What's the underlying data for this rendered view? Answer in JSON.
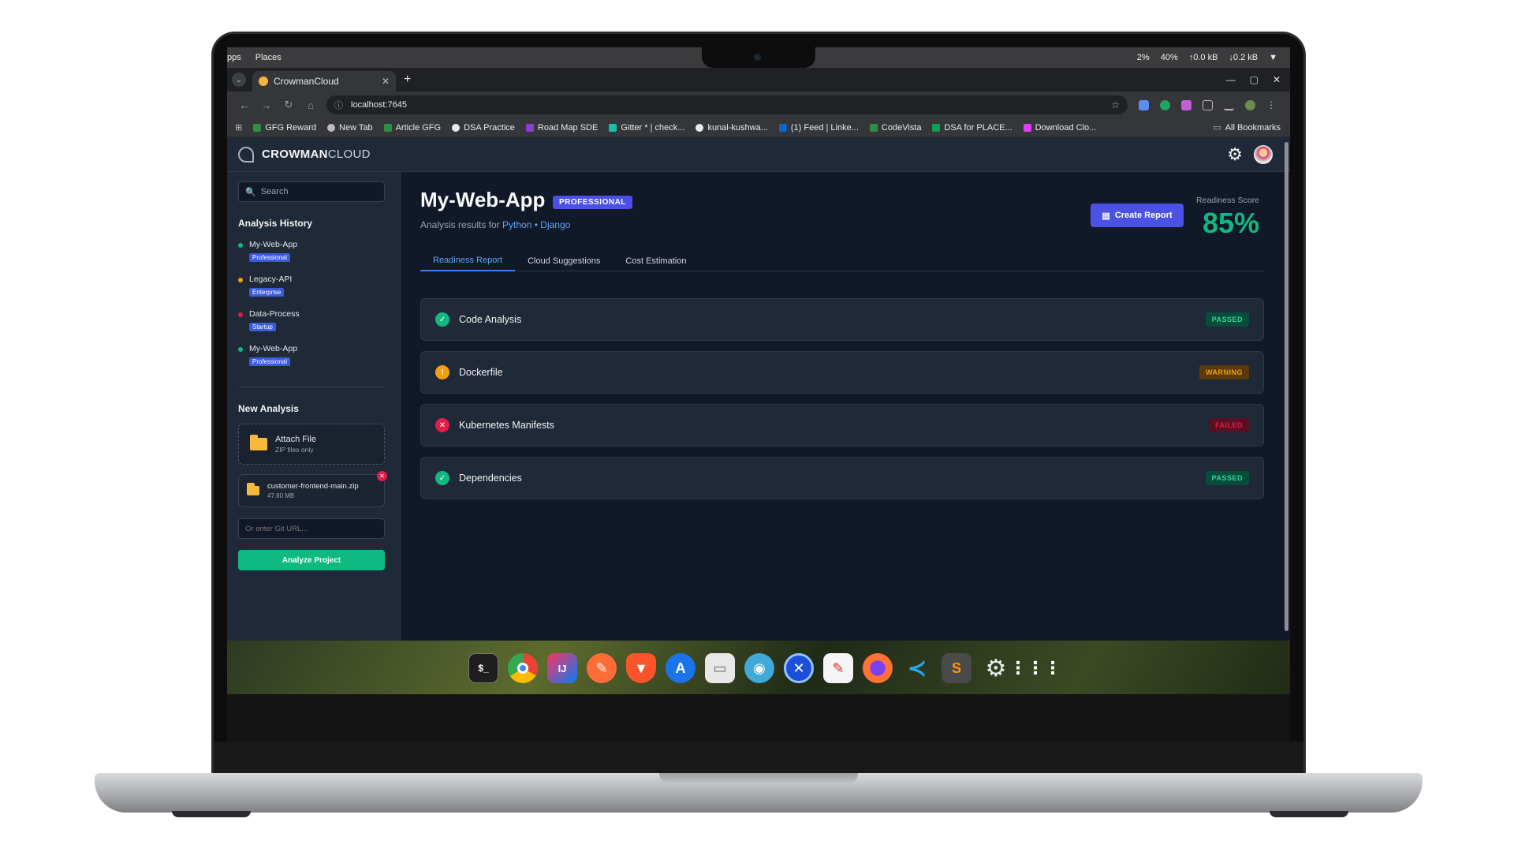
{
  "os_bar": {
    "left": [
      "pps",
      "Places"
    ],
    "right": [
      "2%",
      "40%",
      "↑0.0 kB",
      "↓0.2 kB"
    ]
  },
  "browser": {
    "tab_title": "CrowmanCloud",
    "new_tab_symbol": "+",
    "url": "localhost:7645",
    "bookmarks": [
      "GFG Reward",
      "New Tab",
      "Article GFG",
      "DSA Practice",
      "Road Map SDE",
      "Gitter * | check...",
      "kunal-kushwa...",
      "(1) Feed | Linke...",
      "CodeVista",
      "DSA for PLACE...",
      "Download Clo..."
    ],
    "all_bookmarks": "All Bookmarks"
  },
  "app": {
    "brand_bold": "CROWMAN",
    "brand_light": "CLOUD",
    "search_placeholder": "Search",
    "history_title": "Analysis History",
    "history": [
      {
        "name": "My-Web-App",
        "tier": "Professional",
        "status_color": "#10b981"
      },
      {
        "name": "Legacy-API",
        "tier": "Enterprise",
        "status_color": "#f59e0b"
      },
      {
        "name": "Data-Process",
        "tier": "Startup",
        "status_color": "#e11d48"
      },
      {
        "name": "My-Web-App",
        "tier": "Professional",
        "status_color": "#10b981"
      }
    ],
    "new_analysis_title": "New Analysis",
    "attach": {
      "title": "Attach File",
      "subtitle": "ZIP files only"
    },
    "file": {
      "name": "customer-frontend-main.zip",
      "size": "47.80 MB"
    },
    "git_placeholder": "Or enter Git URL...",
    "analyze_label": "Analyze Project"
  },
  "main": {
    "project_title": "My-Web-App",
    "project_badge": "PROFESSIONAL",
    "results_prefix": "Analysis results for",
    "stack": "Python • Django",
    "create_report_label": "Create Report",
    "readiness_label": "Readiness Score",
    "readiness_score": "85%",
    "tabs": [
      "Readiness Report",
      "Cloud Suggestions",
      "Cost Estimation"
    ],
    "checks": [
      {
        "label": "Code Analysis",
        "status": "PASSED",
        "symbol": "✓",
        "color": "#10b981"
      },
      {
        "label": "Dockerfile",
        "status": "WARNING",
        "symbol": "!",
        "color": "#f59e0b"
      },
      {
        "label": "Kubernetes Manifests",
        "status": "FAILED",
        "symbol": "✕",
        "color": "#e11d48"
      },
      {
        "label": "Dependencies",
        "status": "PASSED",
        "symbol": "✓",
        "color": "#10b981"
      }
    ]
  },
  "dock": [
    "terminal",
    "chrome",
    "intellij",
    "postman",
    "brave",
    "app-store",
    "files",
    "eye",
    "settings-circle",
    "document-editor",
    "firefox",
    "vscode",
    "sublime",
    "gear",
    "app-grid"
  ]
}
